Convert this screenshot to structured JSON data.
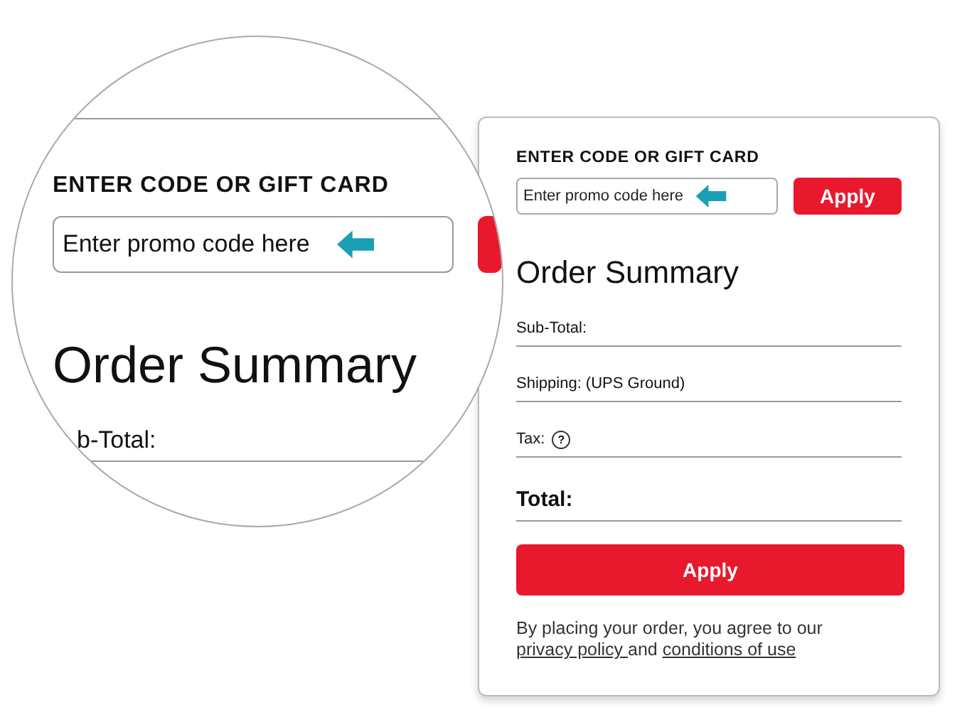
{
  "magnifier": {
    "heading": "ENTER CODE OR GIFT CARD",
    "placeholder": "Enter promo code here",
    "title": "Order Summary",
    "line_label": "b-Total:"
  },
  "card": {
    "promo": {
      "heading": "ENTER CODE OR GIFT CARD",
      "placeholder": "Enter promo code here",
      "button": "Apply"
    },
    "title": "Order Summary",
    "lines": [
      {
        "label": "Sub-Total:",
        "kind": "plain"
      },
      {
        "label": "Shipping: (UPS Ground)",
        "kind": "plain"
      },
      {
        "label": "Tax:",
        "kind": "help",
        "help": "?"
      },
      {
        "label": "Total:",
        "kind": "total"
      }
    ],
    "submit": "Apply",
    "legal": {
      "before": "By placing your order, you agree to our ",
      "link_1": "privacy policy ",
      "middle": "and ",
      "link_2": "conditions of use"
    }
  }
}
